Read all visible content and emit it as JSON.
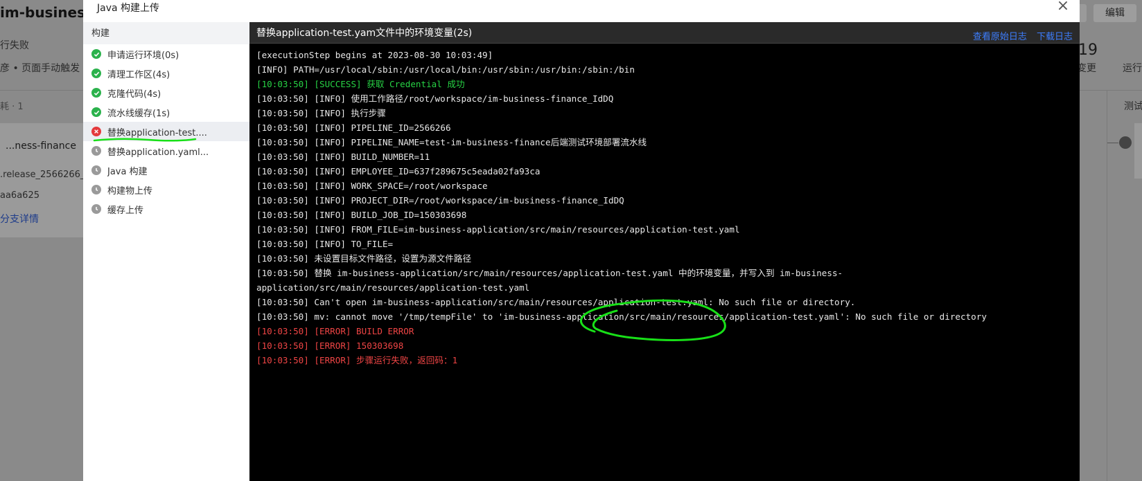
{
  "background": {
    "page_title": "im-business-fin",
    "status": "行失败",
    "trigger": "彦 • 页面手动触发",
    "stage_info": "耗 · 1",
    "card_name": "...ness-finance",
    "branch": ".release_2566266_",
    "commit": "aa6a625",
    "branch_detail_link": "分支详情",
    "edit_label": "编辑",
    "count": "19",
    "change_label": "码变更",
    "run_label": "运行",
    "test_label": "测试"
  },
  "modal": {
    "title": "Java 构建上传",
    "close_symbol": "×"
  },
  "steps": {
    "header": "构建",
    "items": [
      {
        "label": "申请运行环境(0s)",
        "status": "success"
      },
      {
        "label": "清理工作区(4s)",
        "status": "success"
      },
      {
        "label": "克隆代码(4s)",
        "status": "success"
      },
      {
        "label": "流水线缓存(1s)",
        "status": "success"
      },
      {
        "label": "替换application-test....",
        "status": "failed"
      },
      {
        "label": "替换application.yaml...",
        "status": "pending"
      },
      {
        "label": "Java 构建",
        "status": "pending"
      },
      {
        "label": "构建物上传",
        "status": "pending"
      },
      {
        "label": "缓存上传",
        "status": "pending"
      }
    ]
  },
  "log": {
    "title": "替换application-test.yam文件中的环境变量(2s)",
    "view_raw": "查看原始日志",
    "download": "下载日志",
    "lines": [
      {
        "text": "[executionStep begins at 2023-08-30 10:03:49]",
        "level": "normal"
      },
      {
        "text": "[INFO] PATH=/usr/local/sbin:/usr/local/bin:/usr/sbin:/usr/bin:/sbin:/bin",
        "level": "normal"
      },
      {
        "text": "[10:03:50] [SUCCESS] 获取 Credential 成功",
        "level": "success"
      },
      {
        "text": "[10:03:50] [INFO] 使用工作路径/root/workspace/im-business-finance_IdDQ",
        "level": "normal"
      },
      {
        "text": "[10:03:50] [INFO] 执行步骤",
        "level": "normal"
      },
      {
        "text": "[10:03:50] [INFO] PIPELINE_ID=2566266",
        "level": "normal"
      },
      {
        "text": "[10:03:50] [INFO] PIPELINE_NAME=test-im-business-finance后端测试环境部署流水线",
        "level": "normal"
      },
      {
        "text": "[10:03:50] [INFO] BUILD_NUMBER=11",
        "level": "normal"
      },
      {
        "text": "[10:03:50] [INFO] EMPLOYEE_ID=637f289675c5eada02fa93ca",
        "level": "normal"
      },
      {
        "text": "[10:03:50] [INFO] WORK_SPACE=/root/workspace",
        "level": "normal"
      },
      {
        "text": "[10:03:50] [INFO] PROJECT_DIR=/root/workspace/im-business-finance_IdDQ",
        "level": "normal"
      },
      {
        "text": "[10:03:50] [INFO] BUILD_JOB_ID=150303698",
        "level": "normal"
      },
      {
        "text": "[10:03:50] [INFO] FROM_FILE=im-business-application/src/main/resources/application-test.yaml",
        "level": "normal"
      },
      {
        "text": "[10:03:50] [INFO] TO_FILE=",
        "level": "normal"
      },
      {
        "text": "[10:03:50] 未设置目标文件路径，设置为源文件路径",
        "level": "normal"
      },
      {
        "text": "[10:03:50] 替换 im-business-application/src/main/resources/application-test.yaml 中的环境变量，并写入到 im-business-",
        "level": "normal"
      },
      {
        "text": "application/src/main/resources/application-test.yaml",
        "level": "normal"
      },
      {
        "text": "[10:03:50] Can't open im-business-application/src/main/resources/application-test.yaml: No such file or directory.",
        "level": "normal"
      },
      {
        "text": "[10:03:50] mv: cannot move '/tmp/tempFile' to 'im-business-application/src/main/resources/application-test.yaml': No such file or directory",
        "level": "normal"
      },
      {
        "text": "[10:03:50] [ERROR] BUILD ERROR",
        "level": "error"
      },
      {
        "text": "[10:03:50] [ERROR] 150303698",
        "level": "error"
      },
      {
        "text": "[10:03:50] [ERROR] 步骤运行失败，返回码：1",
        "level": "error"
      }
    ]
  },
  "colors": {
    "success": "#2bb24c",
    "error": "#e4393c",
    "pending": "#9a9a9a",
    "link": "#3d7eff",
    "annotation": "#18e018"
  }
}
